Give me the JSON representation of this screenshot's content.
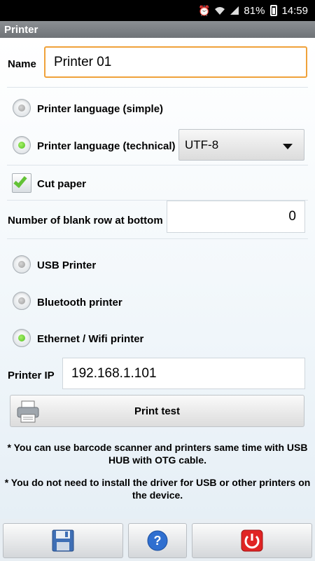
{
  "status_bar": {
    "battery": "81%",
    "time": "14:59",
    "icons": [
      "alarm-icon",
      "wifi-icon",
      "signal-icon",
      "battery-icon"
    ]
  },
  "title": "Printer",
  "name_field": {
    "label": "Name",
    "value": "Printer 01"
  },
  "printer_language": {
    "simple_label": "Printer language (simple)",
    "technical_label": "Printer language (technical)",
    "selected": "technical",
    "encoding": "UTF-8"
  },
  "cut_paper": {
    "label": "Cut paper",
    "checked": true
  },
  "blank_rows": {
    "label": "Number of blank row at bottom",
    "value": "0"
  },
  "connection": {
    "usb_label": "USB Printer",
    "bluetooth_label": "Bluetooth printer",
    "ethernet_label": "Ethernet / Wifi printer",
    "selected": "ethernet"
  },
  "printer_ip": {
    "label": "Printer IP",
    "value": "192.168.1.101"
  },
  "print_test_label": "Print test",
  "notes": [
    "* You can use barcode scanner and printers same time with USB HUB with OTG cable.",
    "* You do not need to install the driver for USB or other printers on the device."
  ],
  "bottom_buttons": [
    "save-icon",
    "help-icon",
    "power-icon"
  ],
  "colors": {
    "accent_focus": "#f0a23a",
    "radio_on": "#4cbf1c",
    "check": "#62c234"
  }
}
